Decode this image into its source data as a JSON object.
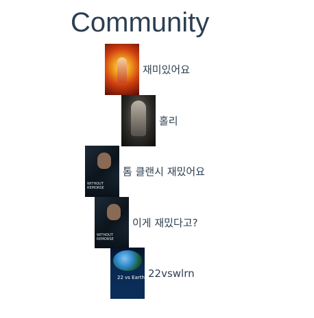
{
  "page": {
    "title": "Community"
  },
  "posts": [
    {
      "label": "재미있어요",
      "poster_icon": "movie-poster-icon"
    },
    {
      "label": "홀리",
      "poster_icon": "movie-poster-icon"
    },
    {
      "label": "톰 클랜시 재밌어요",
      "poster_icon": "movie-poster-icon",
      "poster_caption": "WITHOUT REMORSE"
    },
    {
      "label": "이게 재밌다고?",
      "poster_icon": "movie-poster-icon",
      "poster_caption": "WITHOUT REMORSE"
    },
    {
      "label": "22vswlrn",
      "poster_icon": "movie-poster-icon",
      "poster_caption": "22 vs Earth"
    }
  ]
}
